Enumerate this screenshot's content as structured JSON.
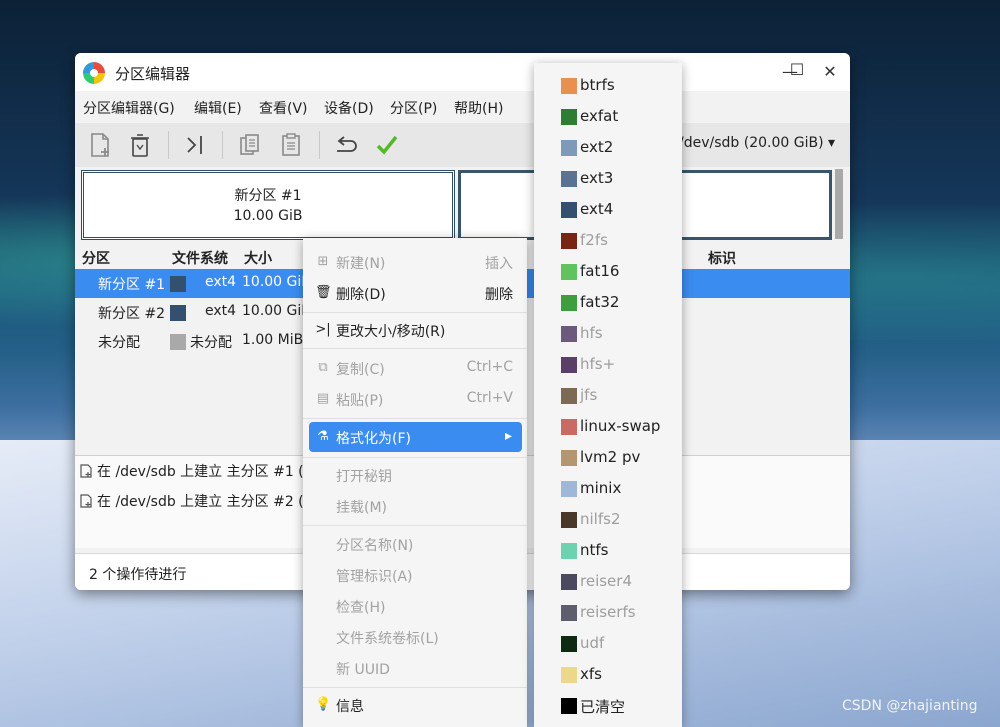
{
  "window": {
    "title": "分区编辑器",
    "minimize": "—",
    "maximize": "☐",
    "close": "✕"
  },
  "menubar": [
    "分区编辑器(G)",
    "编辑(E)",
    "查看(V)",
    "设备(D)",
    "分区(P)",
    "帮助(H)"
  ],
  "toolbar": {
    "icons": [
      "new-partition-icon",
      "delete-icon",
      "resize-move-icon",
      "copy-icon",
      "paste-icon",
      "undo-icon",
      "apply-icon"
    ],
    "device": "/dev/sdb (20.00 GiB)",
    "device_arrow": "▾"
  },
  "partition_graph": {
    "name": "新分区 #1",
    "size": "10.00 GiB"
  },
  "table": {
    "headers": {
      "partition": "分区",
      "filesystem": "文件系统",
      "size": "大小",
      "flags": "标识"
    },
    "rows": [
      {
        "partition": "新分区 #1",
        "fs": "ext4",
        "size": "10.00 GiB",
        "color": "#34506f"
      },
      {
        "partition": "新分区 #2",
        "fs": "ext4",
        "size": "10.00 GiB",
        "color": "#34506f"
      },
      {
        "partition": "未分配",
        "fs": "未分配",
        "size": "1.00 MiB",
        "color": "#a9a9a9"
      }
    ]
  },
  "operations": [
    "在 /dev/sdb 上建立 主分区 #1 (",
    "在 /dev/sdb 上建立 主分区 #2 ("
  ],
  "status": "2 个操作待进行",
  "context_menu": {
    "new": "新建(N)",
    "new_acc": "插入",
    "delete": "删除(D)",
    "delete_acc": "删除",
    "resize": "更改大小/移动(R)",
    "copy": "复制(C)",
    "copy_acc": "Ctrl+C",
    "paste": "粘贴(P)",
    "paste_acc": "Ctrl+V",
    "format": "格式化为(F)",
    "format_arrow": "▸",
    "open_key": "打开秘钥",
    "mount": "挂载(M)",
    "name": "分区名称(N)",
    "flags": "管理标识(A)",
    "check": "检查(H)",
    "label": "文件系统卷标(L)",
    "uuid": "新 UUID",
    "info": "信息"
  },
  "filesystems": [
    {
      "name": "btrfs",
      "color": "#e8914e",
      "enabled": true
    },
    {
      "name": "exfat",
      "color": "#2e7d32",
      "enabled": true
    },
    {
      "name": "ext2",
      "color": "#7f9ab8",
      "enabled": true
    },
    {
      "name": "ext3",
      "color": "#5a7390",
      "enabled": true
    },
    {
      "name": "ext4",
      "color": "#34506f",
      "enabled": true
    },
    {
      "name": "f2fs",
      "color": "#7a2416",
      "enabled": false
    },
    {
      "name": "fat16",
      "color": "#5fc45f",
      "enabled": true
    },
    {
      "name": "fat32",
      "color": "#3e9e3e",
      "enabled": true
    },
    {
      "name": "hfs",
      "color": "#6d5a7a",
      "enabled": false
    },
    {
      "name": "hfs+",
      "color": "#5a3f66",
      "enabled": false
    },
    {
      "name": "jfs",
      "color": "#7d6a55",
      "enabled": false
    },
    {
      "name": "linux-swap",
      "color": "#c96a64",
      "enabled": true
    },
    {
      "name": "lvm2 pv",
      "color": "#b59672",
      "enabled": true
    },
    {
      "name": "minix",
      "color": "#9fb8d8",
      "enabled": true
    },
    {
      "name": "nilfs2",
      "color": "#4a3828",
      "enabled": false
    },
    {
      "name": "ntfs",
      "color": "#6dd2b0",
      "enabled": true
    },
    {
      "name": "reiser4",
      "color": "#4a4a5e",
      "enabled": false
    },
    {
      "name": "reiserfs",
      "color": "#5d5d6e",
      "enabled": false
    },
    {
      "name": "udf",
      "color": "#0e2a12",
      "enabled": false
    },
    {
      "name": "xfs",
      "color": "#ecd78a",
      "enabled": true
    },
    {
      "name": "已清空",
      "color": "#000000",
      "enabled": true
    }
  ],
  "watermark": "CSDN @zhajianting"
}
